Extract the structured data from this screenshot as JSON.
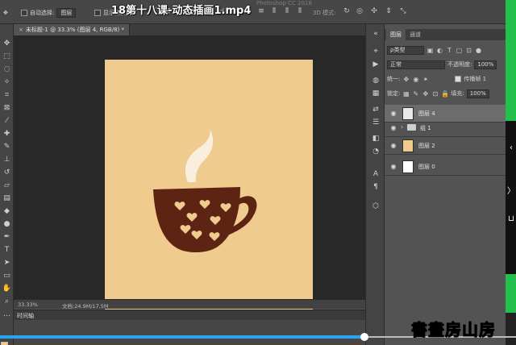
{
  "video": {
    "title": "18第十八课-动态插画1.mp4",
    "faint_app_name": "Photoshop CC 2018",
    "watermark": "書畫房山房",
    "progress_percent": 70.6
  },
  "options_bar": {
    "auto_select_label": "自动选择:",
    "auto_select_value": "图层",
    "show_transform_label": "显示变换控件",
    "mode_3d_label": "3D 模式:"
  },
  "document": {
    "tab_title": "未标题-1 @ 33.3% (图层 4, RGB/8) *",
    "tab_close": "×",
    "zoom": "33.33%",
    "doc_info": "文档:24.9M/17.5M",
    "canvas_color": "#f0cb8e"
  },
  "timeline": {
    "tab_label": "时间轴"
  },
  "layers_panel": {
    "tabs": [
      "图层",
      "通道"
    ],
    "filter_kind": "ρ类型",
    "blend_mode": "正常",
    "opacity_label": "不透明度:",
    "opacity_value": "100%",
    "unify_label": "统一:",
    "propagate_label": "传播帧 1",
    "lock_label": "锁定:",
    "fill_label": "填充:",
    "fill_value": "100%",
    "layers": [
      {
        "name": "图层 4",
        "type": "layer",
        "selected": true,
        "thumb_color": "#e9e9e9"
      },
      {
        "name": "组 1",
        "type": "group",
        "selected": false,
        "thumb_color": ""
      },
      {
        "name": "图层 2",
        "type": "layer",
        "selected": false,
        "thumb_color": "#f0cb8e"
      },
      {
        "name": "图层 0",
        "type": "layer",
        "selected": false,
        "thumb_color": "#ffffff"
      }
    ]
  },
  "colors": {
    "cup": "#5e2413",
    "steam": "#faeedd",
    "accent_blue": "#2aa3f0"
  },
  "icons": {
    "eye": "eye-icon",
    "folder": "folder-icon"
  }
}
